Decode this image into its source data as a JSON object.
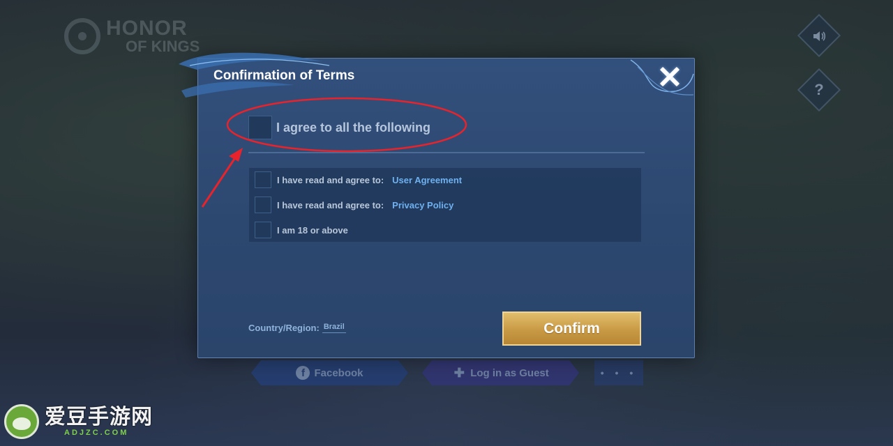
{
  "background": {
    "logo_line1": "HONOR",
    "logo_line2": "OF KINGS",
    "sound_icon": "speaker-icon",
    "help_icon": "question-mark-icon",
    "login_buttons": {
      "facebook": "Facebook",
      "guest": "Log in as Guest",
      "more": "• • •"
    }
  },
  "dialog": {
    "title": "Confirmation of Terms",
    "agree_all_label": "I agree to all the following",
    "terms": [
      {
        "text": "I have read and agree to:",
        "link": "User Agreement"
      },
      {
        "text": "I have read and agree to:",
        "link": "Privacy Policy"
      },
      {
        "text": "I am 18 or above",
        "link": ""
      }
    ],
    "region_label": "Country/Region:",
    "region_value": "Brazil",
    "confirm_label": "Confirm"
  },
  "watermark": {
    "cn": "爱豆手游网",
    "en": "ADJZC.COM"
  },
  "colors": {
    "dialog_bg": "#2d4870",
    "link": "#6fb1f0",
    "confirm_gold": "#c99a45",
    "annotation_red": "#e8232b"
  }
}
